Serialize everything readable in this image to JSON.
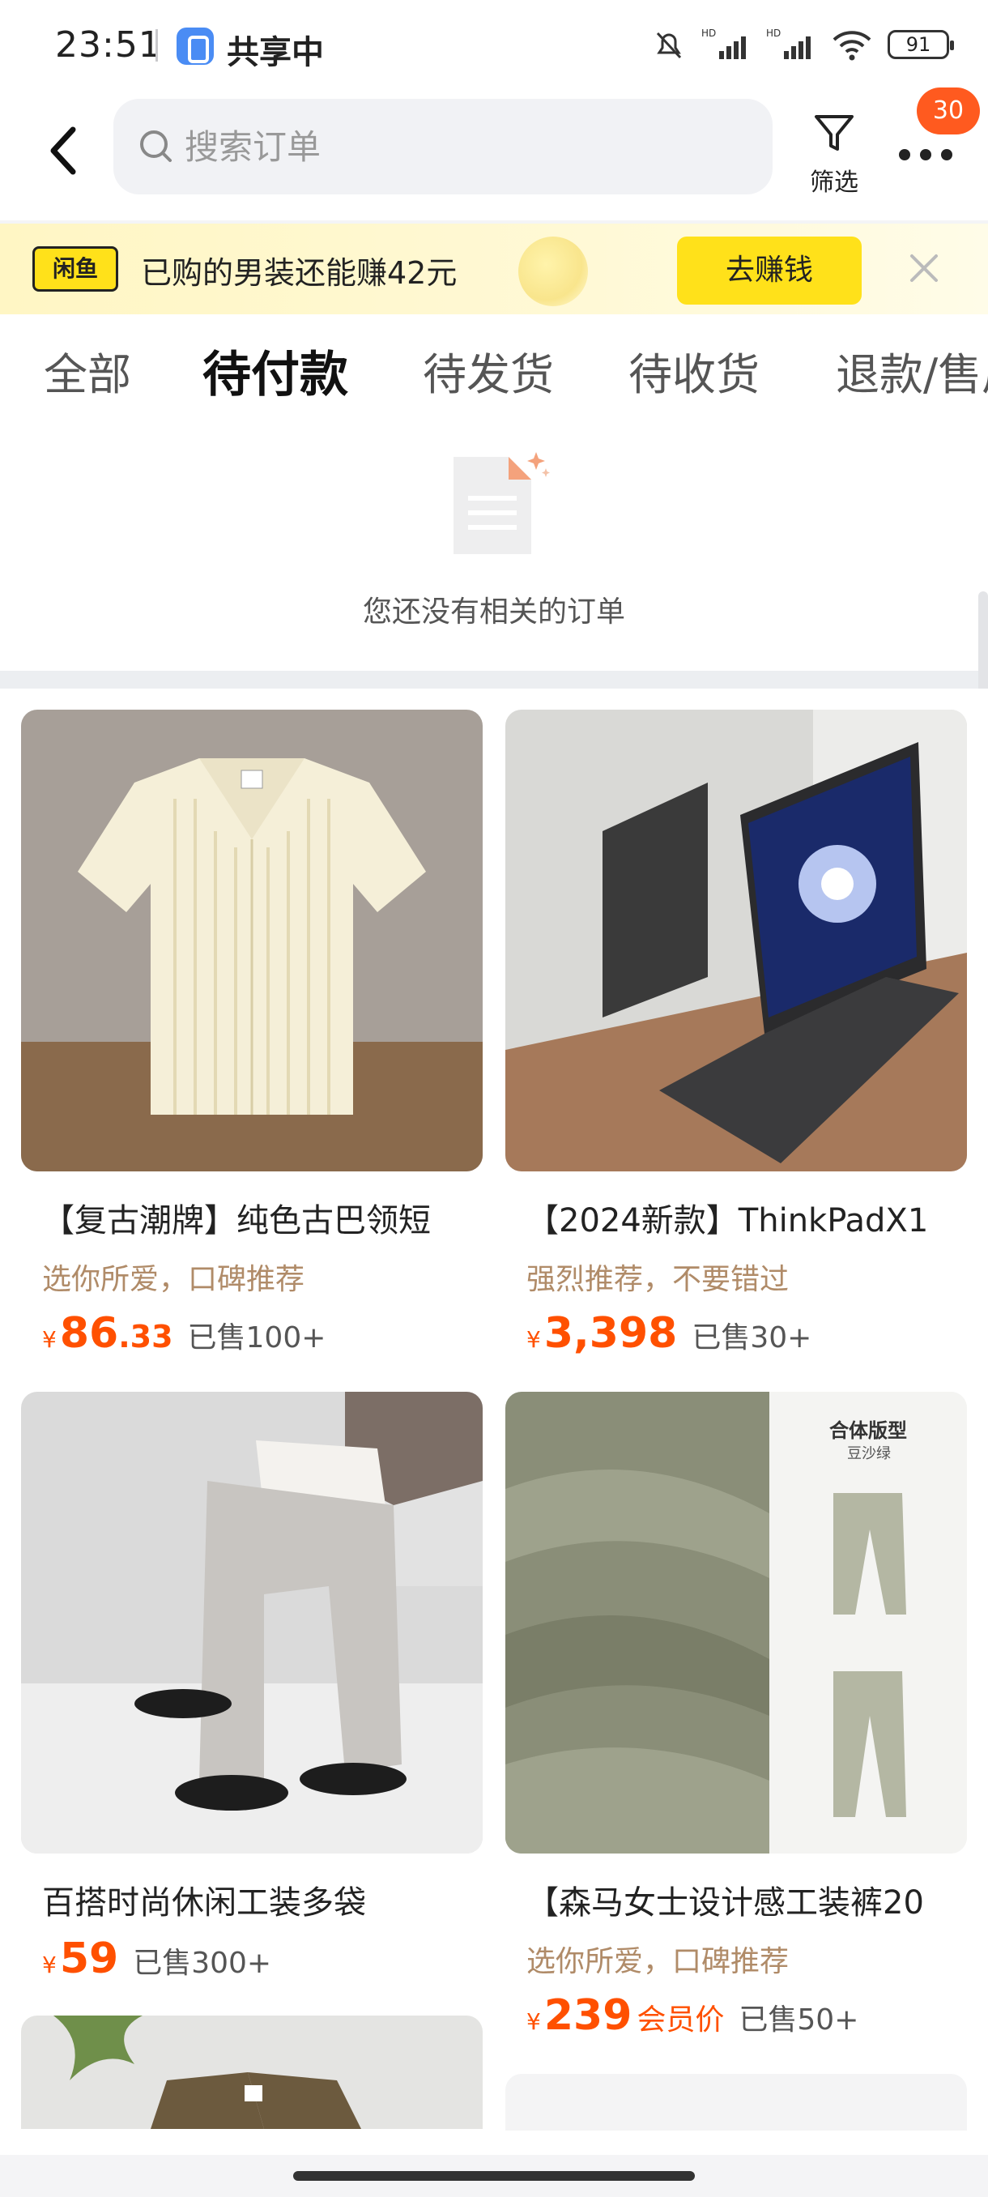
{
  "status_bar": {
    "time": "23:51",
    "share_label": "共享中",
    "battery": "91"
  },
  "header": {
    "search_placeholder": "搜索订单",
    "filter_label": "筛选",
    "message_badge": "30"
  },
  "promo": {
    "logo": "闲鱼",
    "text": "已购的男装还能赚42元",
    "button": "去赚钱"
  },
  "tabs": [
    {
      "label": "全部",
      "active": false
    },
    {
      "label": "待付款",
      "active": true
    },
    {
      "label": "待发货",
      "active": false
    },
    {
      "label": "待收货",
      "active": false
    },
    {
      "label": "退款/售后",
      "active": false
    }
  ],
  "empty_state": {
    "text": "您还没有相关的订单"
  },
  "products": [
    {
      "title": "【复古潮牌】纯色古巴领短",
      "subtitle": "选你所爱，口碑推荐",
      "currency": "¥",
      "price_int": "86",
      "price_dec": ".33",
      "member": "",
      "sold": "已售100+"
    },
    {
      "title": "【2024新款】ThinkPadX1",
      "subtitle": "强烈推荐，不要错过",
      "currency": "¥",
      "price_int": "3,398",
      "price_dec": "",
      "member": "",
      "sold": "已售30+"
    },
    {
      "title": "百搭时尚休闲工装多袋",
      "subtitle": "",
      "currency": "¥",
      "price_int": "59",
      "price_dec": "",
      "member": "",
      "sold": "已售300+"
    },
    {
      "title": "【森马女士设计感工装裤20",
      "subtitle": "选你所爱，口碑推荐",
      "currency": "¥",
      "price_int": "239",
      "price_dec": "",
      "member": "会员价",
      "sold": "已售50+",
      "image_text_1": "合体版型",
      "image_text_2": "豆沙绿"
    }
  ],
  "colors": {
    "price": "#ff5000",
    "accent_yellow": "#ffe11a",
    "badge": "#ff5a1f"
  }
}
